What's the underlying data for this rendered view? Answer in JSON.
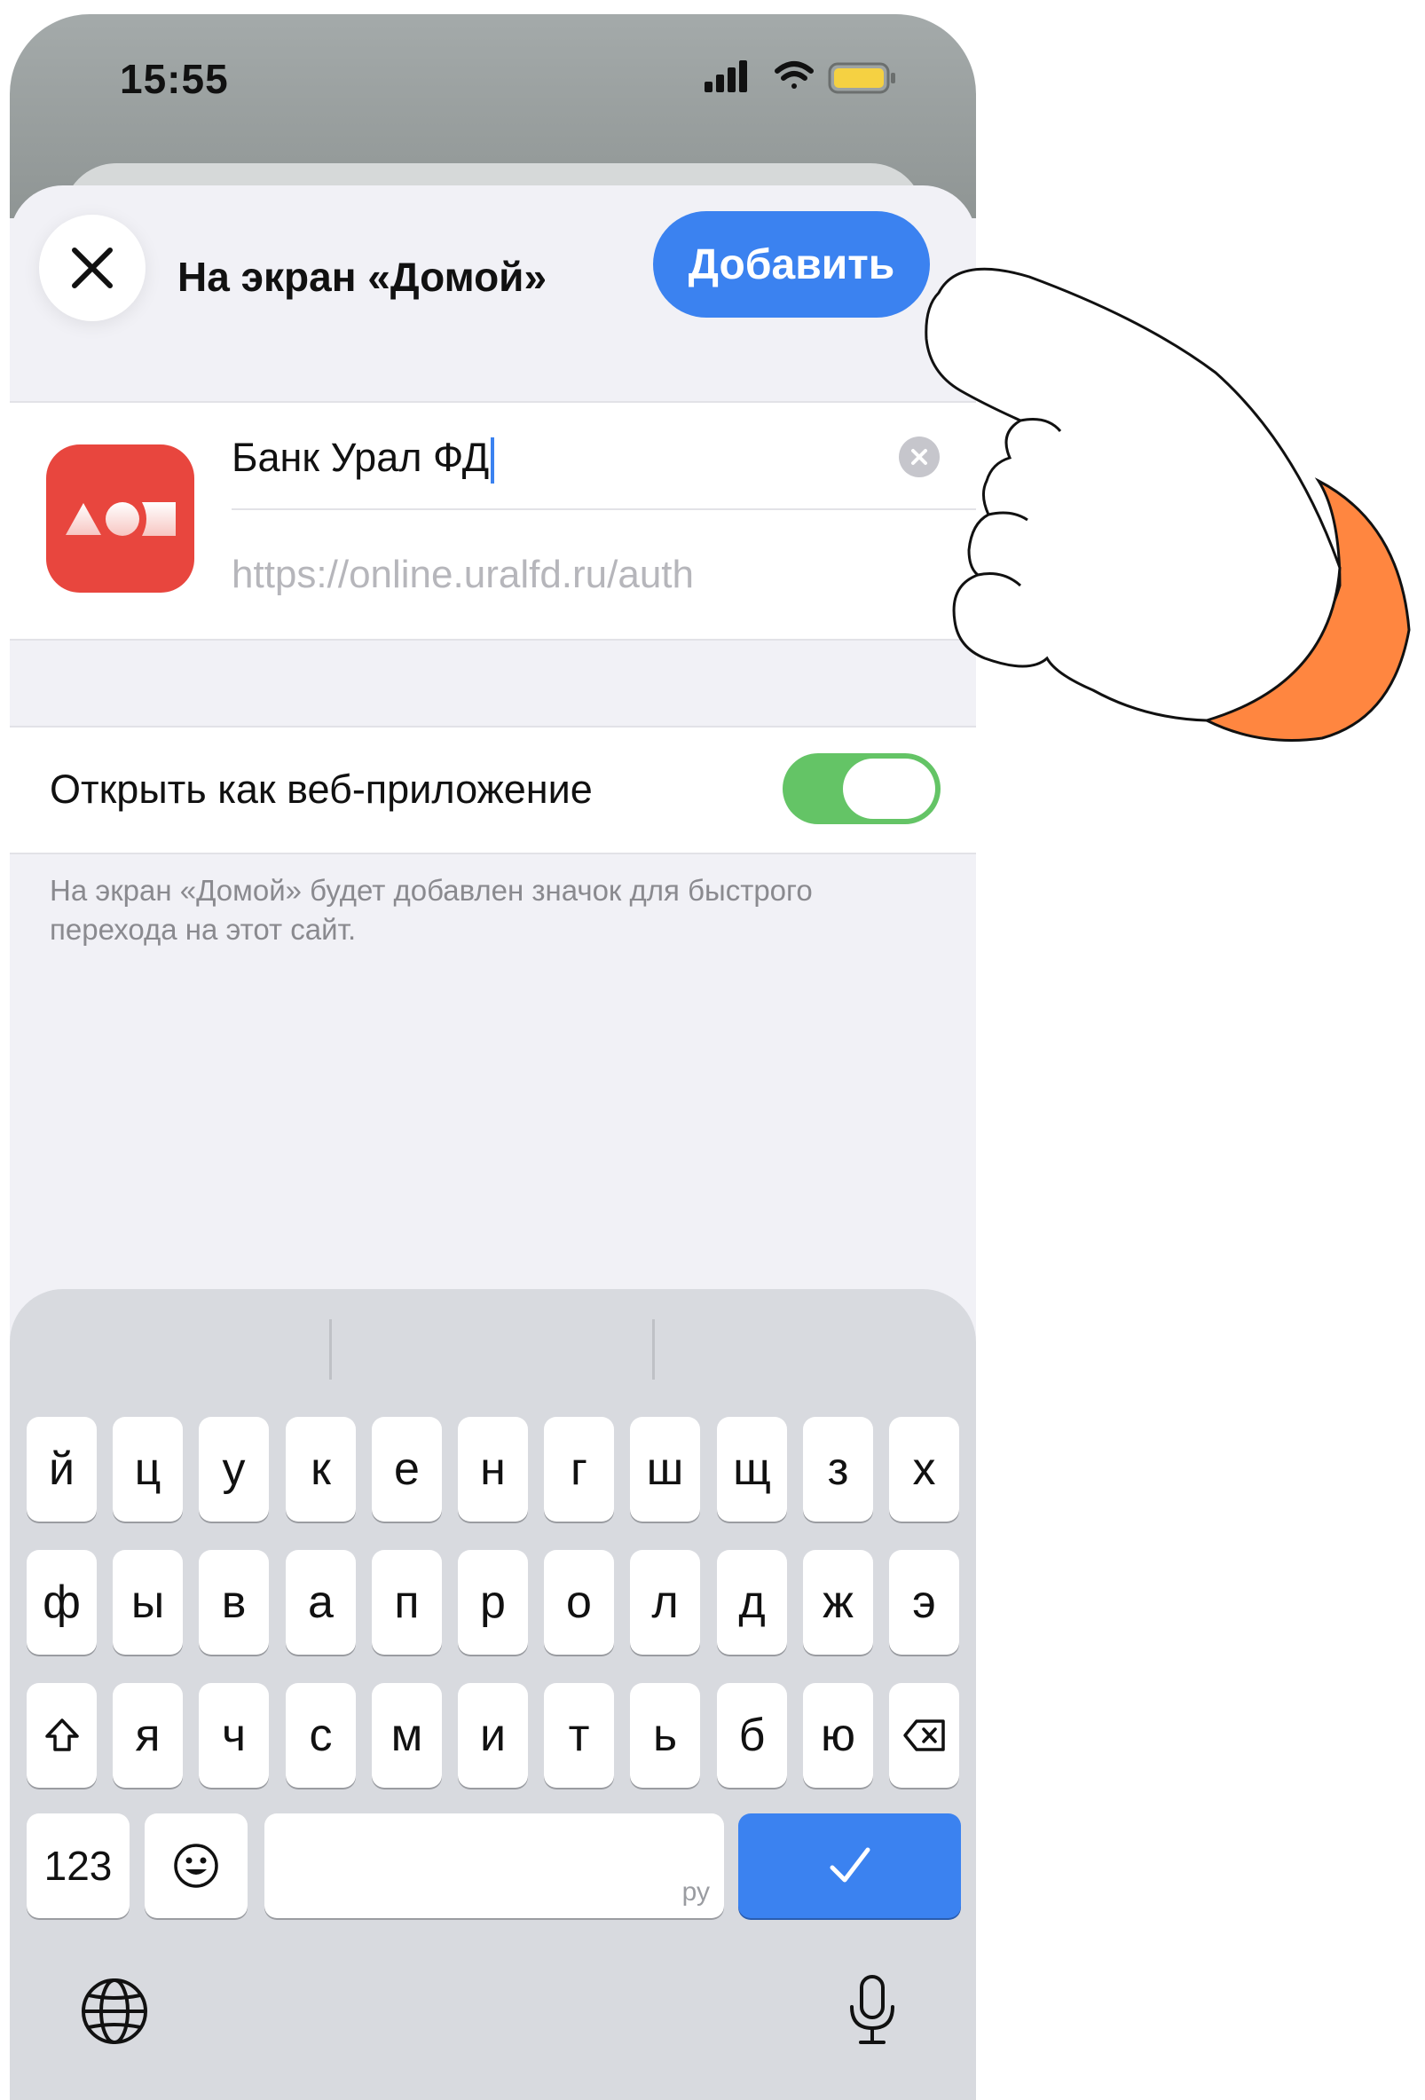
{
  "status_bar": {
    "time": "15:55"
  },
  "sheet": {
    "title": "На экран «Домой»",
    "add_label": "Добавить",
    "name_value": "Банк Урал ФД",
    "url_value": "https://online.uralfd.ru/auth",
    "toggle_label": "Открыть как веб-приложение",
    "toggle_on": true,
    "hint": "На экран «Домой» будет добавлен значок для быстрого перехода на этот сайт."
  },
  "keyboard": {
    "rows": [
      [
        "й",
        "ц",
        "у",
        "к",
        "е",
        "н",
        "г",
        "ш",
        "щ",
        "з",
        "х"
      ],
      [
        "ф",
        "ы",
        "в",
        "а",
        "п",
        "р",
        "о",
        "л",
        "д",
        "ж",
        "э"
      ],
      [
        "я",
        "ч",
        "с",
        "м",
        "и",
        "т",
        "ь",
        "б",
        "ю"
      ]
    ],
    "numbers_label": "123",
    "space_lang": "ру"
  },
  "colors": {
    "accent": "#3b82f0",
    "toggle": "#64c466",
    "app_icon": "#e8463e",
    "hand_sleeve": "#ff8640"
  }
}
